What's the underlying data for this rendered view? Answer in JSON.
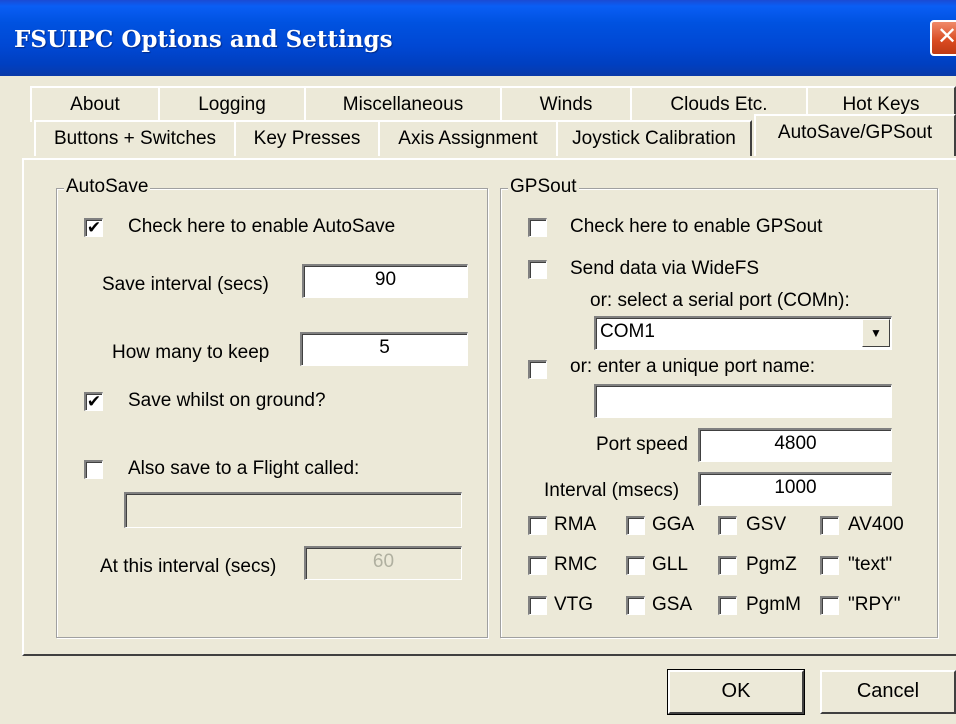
{
  "window": {
    "title": "FSUIPC Options and Settings",
    "close_icon": "close-icon"
  },
  "tabs_row1": [
    "About",
    "Logging",
    "Miscellaneous",
    "Winds",
    "Clouds Etc.",
    "Hot Keys"
  ],
  "tabs_row2": [
    "Buttons + Switches",
    "Key Presses",
    "Axis Assignment",
    "Joystick Calibration",
    "AutoSave/GPSout"
  ],
  "active_tab": "AutoSave/GPSout",
  "autosave": {
    "group_label": "AutoSave",
    "enable_label": "Check here to enable AutoSave",
    "enable_checked": "✔",
    "interval_label": "Save interval (secs)",
    "interval_value": "90",
    "keep_label": "How many to keep",
    "keep_value": "5",
    "ground_label": "Save whilst on ground?",
    "ground_checked": "✔",
    "flight_label": "Also save to a Flight called:",
    "flight_value": "",
    "at_interval_label": "At this interval (secs)",
    "at_interval_value": "60"
  },
  "gpsout": {
    "group_label": "GPSout",
    "enable_label": "Check here to enable GPSout",
    "widefs_label": "Send data via WideFS",
    "serial_label": "or: select a serial port (COMn):",
    "serial_value": "COM1",
    "portname_label": "or: enter a unique port name:",
    "portname_value": "",
    "speed_label": "Port speed",
    "speed_value": "4800",
    "interval_label": "Interval (msecs)",
    "interval_value": "1000",
    "sentences": [
      [
        "RMA",
        "GGA",
        "GSV",
        "AV400"
      ],
      [
        "RMC",
        "GLL",
        "PgmZ",
        "\"text\""
      ],
      [
        "VTG",
        "GSA",
        "PgmM",
        "\"RPY\""
      ]
    ]
  },
  "buttons": {
    "ok": "OK",
    "cancel": "Cancel"
  }
}
